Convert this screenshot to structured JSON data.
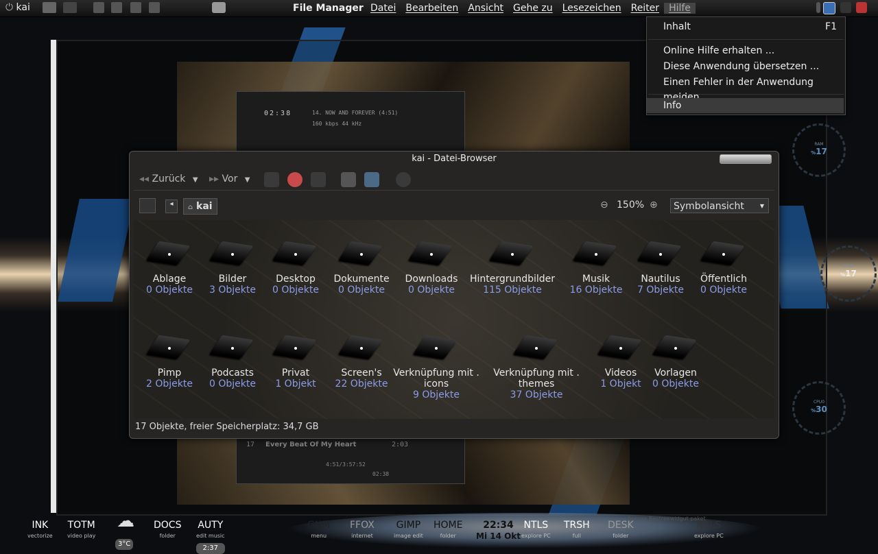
{
  "panel": {
    "user": "kai",
    "app_name": "File Manager",
    "menu": [
      "Datei",
      "Bearbeiten",
      "Ansicht",
      "Gehe zu",
      "Lesezeichen",
      "Reiter",
      "Hilfe"
    ]
  },
  "help_menu": {
    "items": [
      {
        "label": "Inhalt",
        "accel": "F1"
      },
      {
        "label": "Online Hilfe erhalten ..."
      },
      {
        "label": "Diese Anwendung übersetzen ..."
      },
      {
        "label": "Einen Fehler in der Anwendung melden"
      },
      {
        "label": "Info"
      }
    ]
  },
  "player_top": {
    "time": "02:38",
    "track": "14. NOW AND FOREVER (4:51)",
    "rate": "160 kbps    44 kHz"
  },
  "player_bottom": {
    "num": "17",
    "title": "Every Beat Of My Heart",
    "dur": "2:03",
    "counter": "4:51/3:57:52",
    "elapsed": "02:38"
  },
  "gauges": [
    {
      "label": "RAM",
      "value": "17",
      "prefix": "%"
    },
    {
      "label": "CPU1",
      "value": "17",
      "prefix": "%"
    },
    {
      "label": "CPU0",
      "value": "30",
      "prefix": "%"
    }
  ],
  "window": {
    "title": "kai - Datei-Browser",
    "back": "Zurück",
    "forward": "Vor",
    "location": "kai",
    "zoom": "150%",
    "view": "Symbolansicht",
    "status": "17 Objekte, freier Speicherplatz: 34,7 GB"
  },
  "folders": [
    {
      "name": "Ablage",
      "count": "0 Objekte"
    },
    {
      "name": "Bilder",
      "count": "3 Objekte"
    },
    {
      "name": "Desktop",
      "count": "0 Objekte"
    },
    {
      "name": "Dokumente",
      "count": "0 Objekte"
    },
    {
      "name": "Downloads",
      "count": "0 Objekte"
    },
    {
      "name": "Hintergrundbilder",
      "count": "115 Objekte"
    },
    {
      "name": "Musik",
      "count": "16 Objekte"
    },
    {
      "name": "Nautilus",
      "count": "7 Objekte"
    },
    {
      "name": "Öffentlich",
      "count": "0 Objekte"
    },
    {
      "name": "Pimp",
      "count": "2 Objekte"
    },
    {
      "name": "Podcasts",
      "count": "0 Objekte"
    },
    {
      "name": "Privat",
      "count": "1 Objekt"
    },
    {
      "name": "Screen's",
      "count": "22 Objekte"
    },
    {
      "name": "Verknüpfung mit . icons",
      "count": "9 Objekte"
    },
    {
      "name": "Verknüpfung mit . themes",
      "count": "37 Objekte"
    },
    {
      "name": "Videos",
      "count": "1 Objekt"
    },
    {
      "name": "Vorlagen",
      "count": "0 Objekte"
    }
  ],
  "dock_left": [
    {
      "label": "INK",
      "sub": "vectorize"
    },
    {
      "label": "TOTM",
      "sub": "video play"
    },
    {
      "label": "3°C",
      "sub": ""
    },
    {
      "label": "DOCS",
      "sub": "folder"
    },
    {
      "label": "AUTY",
      "sub": "edit music"
    }
  ],
  "auty_time": "2:37",
  "dock_center": [
    {
      "label": "GNM",
      "sub": "menu"
    },
    {
      "label": "FFOX",
      "sub": "internet"
    },
    {
      "label": "GIMP",
      "sub": "image edit"
    },
    {
      "label": "HOME",
      "sub": "folder"
    },
    {
      "label": "22:34",
      "sub": "Mi 14 Okt"
    },
    {
      "label": "NTLS",
      "sub": "explore PC"
    },
    {
      "label": "TRSH",
      "sub": "full"
    },
    {
      "label": "DESK",
      "sub": "folder"
    },
    {
      "label": "NTLS",
      "sub": "explore PC"
    }
  ],
  "dock_caption": "Sakasa Bestreewidgut paket"
}
